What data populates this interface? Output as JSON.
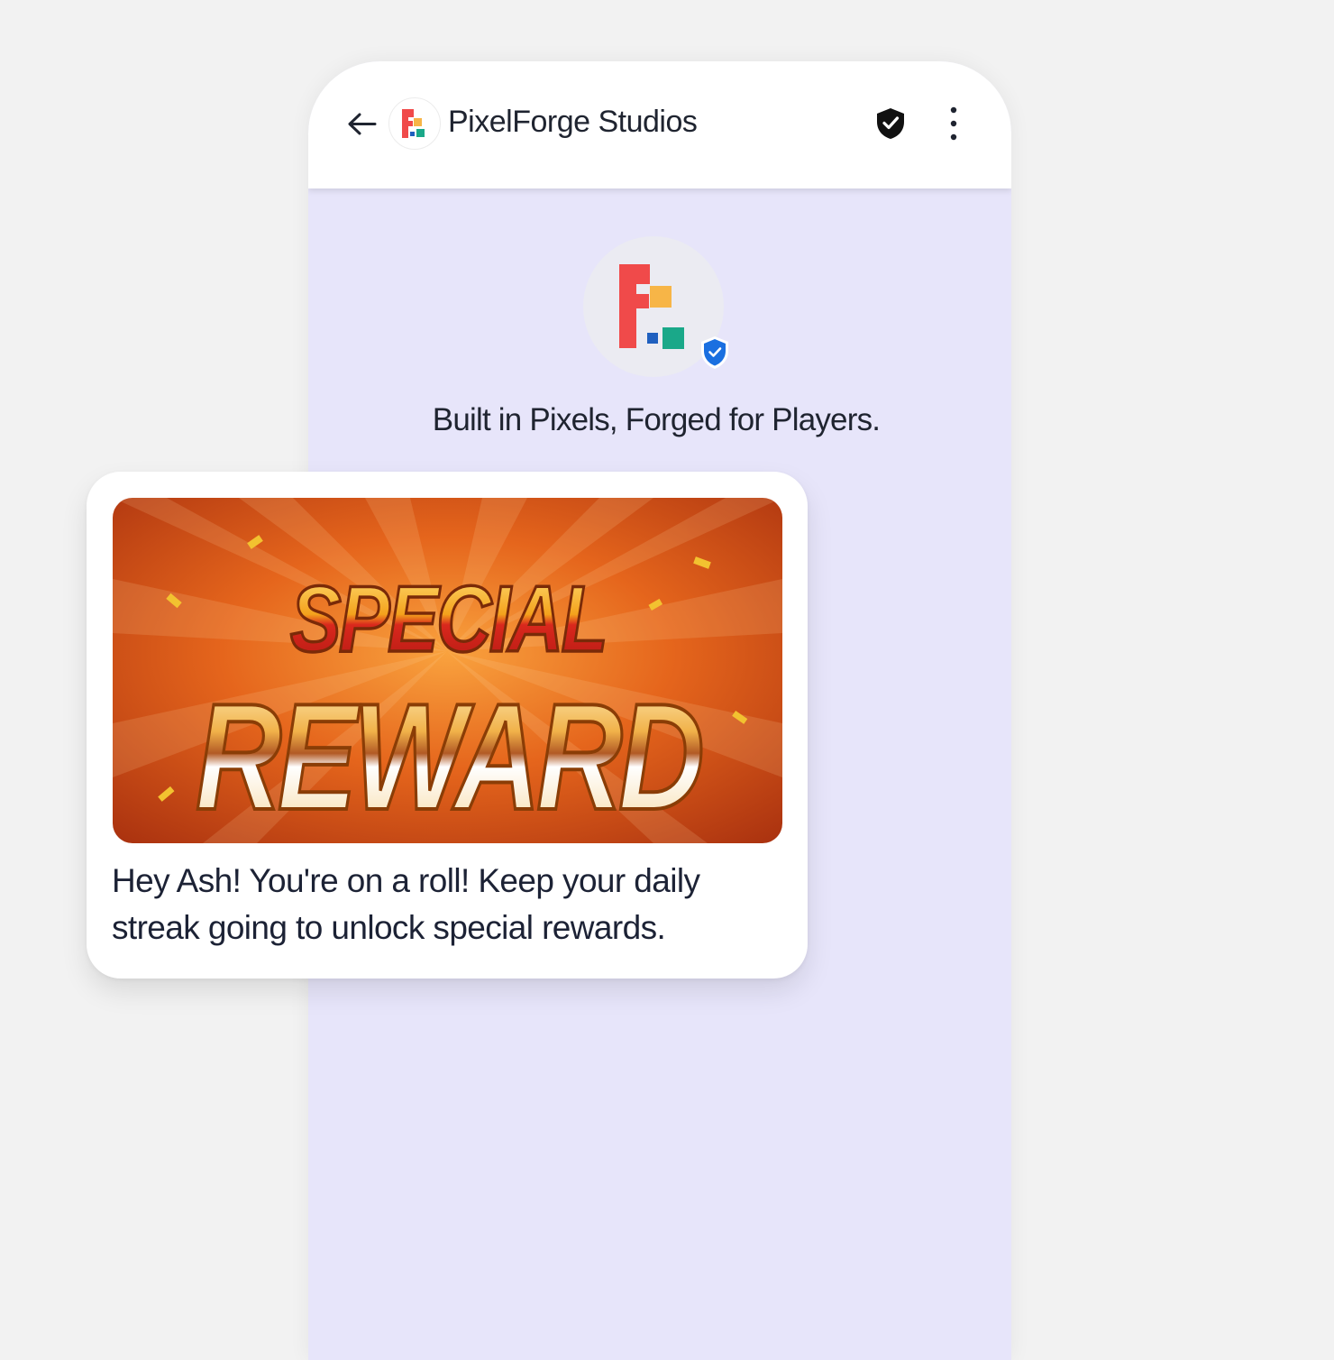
{
  "header": {
    "app_name": "PixelForge Studios",
    "icons": {
      "back": "arrow-left-icon",
      "verified": "verified-shield-icon",
      "more": "more-vertical-icon"
    }
  },
  "profile": {
    "tagline": "Built in Pixels, Forged for Players.",
    "badge": "verified-check-badge-icon"
  },
  "message_card": {
    "banner": {
      "line1": "SPECIAL",
      "line2": "REWARD"
    },
    "text": "Hey Ash! You're on a roll! Keep your daily streak going to unlock special rewards."
  },
  "colors": {
    "chat_background": "#e7e5fa",
    "logo_red": "#f04a4a",
    "logo_orange": "#f7b547",
    "logo_teal": "#1aa889",
    "logo_blue": "#1f5fbf",
    "verified_blue": "#1a6fe0"
  }
}
